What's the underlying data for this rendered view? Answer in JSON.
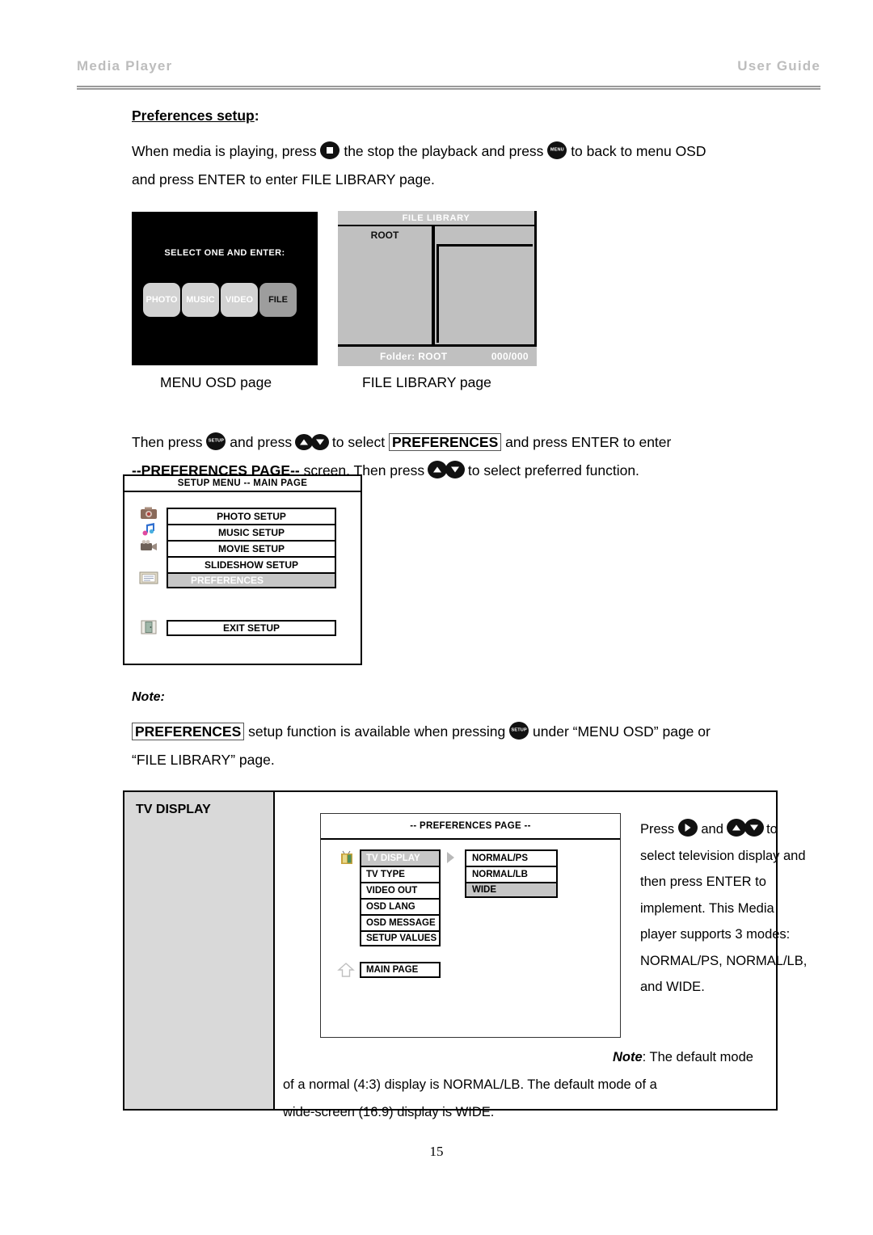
{
  "header": {
    "left": "Media  Player",
    "right": "User  Guide"
  },
  "section": {
    "title_text": "Preferences setup",
    "title_colon": ":"
  },
  "intro": {
    "line1_a": "When media is playing, press",
    "line1_b": "the stop the playback and press",
    "line1_c": "to back to menu OSD",
    "line2": "and press ENTER to enter FILE LIBRARY page."
  },
  "menu_osd": {
    "hint": "SELECT ONE AND ENTER:",
    "buttons": [
      {
        "label": "PHOTO",
        "selected": false
      },
      {
        "label": "MUSIC",
        "selected": false
      },
      {
        "label": "VIDEO",
        "selected": false
      },
      {
        "label": "FILE",
        "selected": true
      }
    ],
    "caption": "MENU OSD page"
  },
  "file_library": {
    "title": "FILE LIBRARY",
    "root": "ROOT",
    "footer_folder": "Folder: ROOT",
    "footer_count": "000/000",
    "caption": "FILE LIBRARY page"
  },
  "instructions": {
    "l1_a": "Then press",
    "l1_b": "and press",
    "l1_c": "to select",
    "l1_badge": "PREFERENCES",
    "l1_d": "and press ENTER to enter",
    "l2_a": "--PREFERENCES PAGE--",
    "l2_b": "screen. Then press",
    "l2_c": "to select preferred function."
  },
  "setup_menu": {
    "title": "SETUP MENU -- MAIN PAGE",
    "rows": [
      {
        "label": "PHOTO SETUP",
        "selected": false,
        "icon": "camera-icon"
      },
      {
        "label": "MUSIC SETUP",
        "selected": false,
        "icon": "music-note-icon"
      },
      {
        "label": "MOVIE SETUP",
        "selected": false,
        "icon": "camcorder-icon"
      },
      {
        "label": "SLIDESHOW SETUP",
        "selected": false,
        "icon": "slideshow-icon"
      },
      {
        "label": "PREFERENCES",
        "selected": true,
        "icon": "preferences-icon"
      }
    ],
    "exit": {
      "label": "EXIT SETUP",
      "icon": "exit-door-icon"
    }
  },
  "note": {
    "heading": "Note:",
    "badge": "PREFERENCES",
    "l1_a": "setup function is available when pressing",
    "l1_b": "under “MENU OSD” page or",
    "l2": "“FILE LIBRARY” page."
  },
  "tv_display": {
    "row_label": "TV DISPLAY",
    "pref_page": {
      "title": "-- PREFERENCES PAGE --",
      "items": [
        {
          "label": "TV DISPLAY",
          "selected": true
        },
        {
          "label": "TV TYPE",
          "selected": false
        },
        {
          "label": "VIDEO OUT",
          "selected": false
        },
        {
          "label": "OSD LANG",
          "selected": false
        },
        {
          "label": "OSD MESSAGE",
          "selected": false
        },
        {
          "label": "SETUP VALUES",
          "selected": false
        }
      ],
      "options": [
        {
          "label": "NORMAL/PS",
          "selected": false
        },
        {
          "label": "NORMAL/LB",
          "selected": false
        },
        {
          "label": "WIDE",
          "selected": true
        }
      ],
      "main_page": "MAIN PAGE",
      "icon": "tv-icon",
      "back_icon": "up-arrow-icon"
    },
    "side_text": {
      "a": "Press",
      "b": "and",
      "c": "to",
      "d": "select television display and then press ENTER to implement. This Media player supports 3 modes: NORMAL/PS, NORMAL/LB, and WIDE."
    },
    "bottom_note": {
      "heading": "Note",
      "text": ": The default mode of a normal (4:3) display is NORMAL/LB. The default mode of a wide-screen (16:9) display is WIDE."
    }
  },
  "page_number": "15",
  "colors": {
    "header_text": "#bdbdbd",
    "osd_background": "#000000",
    "osd_button": "#d2d2d2",
    "osd_button_selected": "#9d9d9d",
    "file_library_bg": "#c0c0c0",
    "highlight": "#c6c6c6",
    "table_label_bg": "#d9d9d9"
  }
}
